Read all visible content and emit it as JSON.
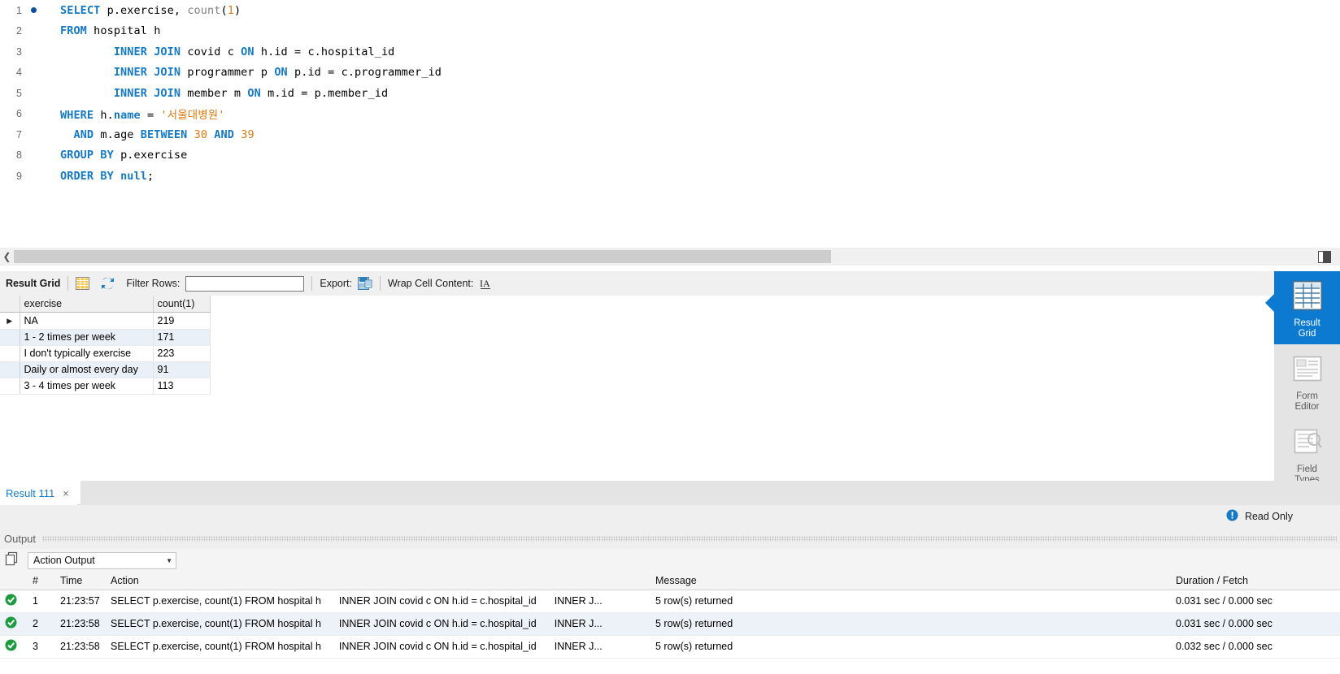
{
  "editor": {
    "lines": [
      {
        "num": "1",
        "breakpoint": true,
        "tokens": [
          {
            "t": "SELECT ",
            "c": "kw"
          },
          {
            "t": "p.exercise, ",
            "c": "pl"
          },
          {
            "t": "count",
            "c": "fn"
          },
          {
            "t": "(",
            "c": "pl"
          },
          {
            "t": "1",
            "c": "num"
          },
          {
            "t": ")",
            "c": "pl"
          }
        ]
      },
      {
        "num": "2",
        "breakpoint": false,
        "tokens": [
          {
            "t": "FROM ",
            "c": "kw"
          },
          {
            "t": "hospital h",
            "c": "pl"
          }
        ]
      },
      {
        "num": "3",
        "breakpoint": false,
        "tokens": [
          {
            "t": "        ",
            "c": "pl"
          },
          {
            "t": "INNER JOIN ",
            "c": "kw"
          },
          {
            "t": "covid c ",
            "c": "pl"
          },
          {
            "t": "ON ",
            "c": "kw"
          },
          {
            "t": "h.id = c.hospital_id",
            "c": "pl"
          }
        ]
      },
      {
        "num": "4",
        "breakpoint": false,
        "tokens": [
          {
            "t": "        ",
            "c": "pl"
          },
          {
            "t": "INNER JOIN ",
            "c": "kw"
          },
          {
            "t": "programmer p ",
            "c": "pl"
          },
          {
            "t": "ON ",
            "c": "kw"
          },
          {
            "t": "p.id = c.programmer_id",
            "c": "pl"
          }
        ]
      },
      {
        "num": "5",
        "breakpoint": false,
        "tokens": [
          {
            "t": "        ",
            "c": "pl"
          },
          {
            "t": "INNER JOIN ",
            "c": "kw"
          },
          {
            "t": "member m ",
            "c": "pl"
          },
          {
            "t": "ON ",
            "c": "kw"
          },
          {
            "t": "m.id = p.member_id",
            "c": "pl"
          }
        ]
      },
      {
        "num": "6",
        "breakpoint": false,
        "tokens": [
          {
            "t": "WHERE ",
            "c": "kw"
          },
          {
            "t": "h.",
            "c": "pl"
          },
          {
            "t": "name",
            "c": "kw"
          },
          {
            "t": " = ",
            "c": "pl"
          },
          {
            "t": "'서울대병원'",
            "c": "str"
          }
        ]
      },
      {
        "num": "7",
        "breakpoint": false,
        "tokens": [
          {
            "t": "  ",
            "c": "pl"
          },
          {
            "t": "AND ",
            "c": "kw"
          },
          {
            "t": "m.age ",
            "c": "pl"
          },
          {
            "t": "BETWEEN ",
            "c": "kw"
          },
          {
            "t": "30",
            "c": "num"
          },
          {
            "t": " ",
            "c": "pl"
          },
          {
            "t": "AND ",
            "c": "kw"
          },
          {
            "t": "39",
            "c": "num"
          }
        ]
      },
      {
        "num": "8",
        "breakpoint": false,
        "tokens": [
          {
            "t": "GROUP BY ",
            "c": "kw"
          },
          {
            "t": "p.exercise",
            "c": "pl"
          }
        ]
      },
      {
        "num": "9",
        "breakpoint": false,
        "tokens": [
          {
            "t": "ORDER BY ",
            "c": "kw"
          },
          {
            "t": "null",
            "c": "kw"
          },
          {
            "t": ";",
            "c": "pl"
          }
        ]
      }
    ]
  },
  "result_toolbar": {
    "title": "Result Grid",
    "filter_label": "Filter Rows:",
    "filter_value": "",
    "filter_placeholder": "",
    "export_label": "Export:",
    "wrap_label": "Wrap Cell Content:"
  },
  "result_grid": {
    "columns": [
      "exercise",
      "count(1)"
    ],
    "rows": [
      {
        "selected": true,
        "exercise": "NA",
        "count": "219"
      },
      {
        "selected": false,
        "exercise": "1 - 2 times per week",
        "count": "171"
      },
      {
        "selected": false,
        "exercise": "I don't typically exercise",
        "count": "223"
      },
      {
        "selected": false,
        "exercise": "Daily or almost every day",
        "count": "91"
      },
      {
        "selected": false,
        "exercise": "3 - 4 times per week",
        "count": "113"
      }
    ]
  },
  "sidebar": {
    "items": [
      {
        "label_top": "Result",
        "label_bottom": "Grid",
        "icon": "grid-icon",
        "active": true
      },
      {
        "label_top": "Form",
        "label_bottom": "Editor",
        "icon": "form-editor-icon",
        "active": false
      },
      {
        "label_top": "Field",
        "label_bottom": "Types",
        "icon": "field-types-icon",
        "active": false
      }
    ],
    "accent_color": "#0b7ad0"
  },
  "result_tab": {
    "label": "Result 111",
    "close": "×"
  },
  "status": {
    "read_only": "Read Only"
  },
  "output": {
    "panel_title": "Output",
    "selected_view": "Action Output",
    "columns": [
      "#",
      "Time",
      "Action",
      "Message",
      "Duration / Fetch"
    ],
    "rows": [
      {
        "status": "success",
        "num": "1",
        "time": "21:23:57",
        "action_a": "SELECT p.exercise, count(1) FROM hospital h",
        "action_b": "INNER JOIN covid c ON h.id = c.hospital_id",
        "action_c": "INNER J...",
        "message": "5 row(s) returned",
        "duration": "0.031 sec / 0.000 sec"
      },
      {
        "status": "success",
        "num": "2",
        "time": "21:23:58",
        "action_a": "SELECT p.exercise, count(1) FROM hospital h",
        "action_b": "INNER JOIN covid c ON h.id = c.hospital_id",
        "action_c": "INNER J...",
        "message": "5 row(s) returned",
        "duration": "0.031 sec / 0.000 sec"
      },
      {
        "status": "success",
        "num": "3",
        "time": "21:23:58",
        "action_a": "SELECT p.exercise, count(1) FROM hospital h",
        "action_b": "INNER JOIN covid c ON h.id = c.hospital_id",
        "action_c": "INNER J...",
        "message": "5 row(s) returned",
        "duration": "0.032 sec / 0.000 sec"
      }
    ]
  }
}
